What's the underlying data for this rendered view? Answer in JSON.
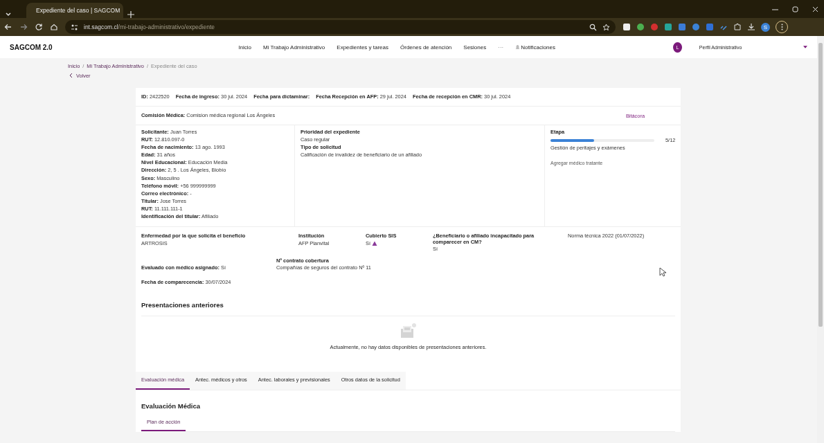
{
  "browser": {
    "tab_title": "Expediente del caso | SAGCOM",
    "url_host": "int.sagcom.cl",
    "url_path": "/mi-trabajo-administrativo/expediente",
    "profile_initial": "S"
  },
  "app": {
    "brand": "SAGCOM 2.0",
    "nav": [
      {
        "label": "Inicio",
        "kind": "link"
      },
      {
        "label": "Mi Trabajo Administrativo",
        "kind": "link"
      },
      {
        "label": "Expedientes y tareas",
        "kind": "link"
      },
      {
        "label": "Órdenes de atención",
        "kind": "link"
      },
      {
        "label": "Sesiones",
        "kind": "link"
      },
      {
        "label": "···",
        "kind": "more"
      },
      {
        "label": "Notificaciones",
        "kind": "bell"
      }
    ],
    "avatar_initial": "L",
    "profile": "Perfil Administrativo"
  },
  "breadcrumbs": [
    "Inicio",
    "Mi Trabajo Administrativo",
    "Expediente del caso"
  ],
  "breadcrumb_separator": "/",
  "back": "Volver",
  "header_fields": [
    {
      "label": "ID:",
      "value": "2422520"
    },
    {
      "label": "Fecha de ingreso:",
      "value": "30 jul. 2024"
    },
    {
      "label": "Fecha para dictaminar:"
    },
    {
      "label": "Fecha Recepción en AFP:",
      "value": "29 jul. 2024"
    },
    {
      "label": "Fecha de recepción en CMR:",
      "value": "30 jul. 2024"
    }
  ],
  "commission": {
    "label": "Comisión Médica:",
    "value": "Comision médica regional Los Ángeles"
  },
  "log_link": "Bitácora",
  "applicant": [
    {
      "label": "Solicitante:",
      "value": "Juan Torres"
    },
    {
      "label": "RUT:",
      "value": "12.810.097-0"
    },
    {
      "label": "Fecha de nacimiento:",
      "value": "13 ago. 1993"
    },
    {
      "label": "Edad:",
      "value": "31 años"
    },
    {
      "label": "Nivel Educacional:",
      "value": "Educación Media"
    },
    {
      "label": "Dirección:",
      "value": "2, 5 . Los Ángeles, Biobío"
    },
    {
      "label": "Sexo:",
      "value": "Masculino"
    },
    {
      "label": "Teléfono móvil:",
      "value": "+56 999999999"
    },
    {
      "label": "Correo electrónico:",
      "value": "-"
    },
    {
      "label": "Titular:",
      "value": "Jose Torres"
    },
    {
      "label": "RUT:",
      "value": "11.111.111-1"
    },
    {
      "label": "Identificación del titular:",
      "value": "Afiliado"
    }
  ],
  "request": [
    {
      "heading": "Prioridad del expediente",
      "value": "Caso regular"
    },
    {
      "heading": "Tipo de solicitud",
      "value": "Calificación de invalidez de beneficiario de un afiliado"
    }
  ],
  "stage": {
    "label": "Etapa",
    "level": 0.42,
    "count": "5/12",
    "name": "Gestión de peritajes y exámenes",
    "link": "Agregar médico tratante"
  },
  "details": {
    "disease": {
      "label": "Enfermedad por la que solicita el beneficio",
      "value": "ARTROSIS"
    },
    "institution": {
      "label": "Institución",
      "value": "AFP Planvital"
    },
    "sis": {
      "label": "Cubierto SIS",
      "value": "Sí",
      "warning": true
    },
    "incapacitated": {
      "label": "¿Beneficiario o afiliado incapacitado para comparecer en CM?",
      "value": "Sí"
    },
    "norm": "Norma técnica 2022 (01/07/2022)",
    "contract": {
      "label": "Nº contrato cobertura",
      "value": "Compañías de seguros del contrato Nº 11"
    },
    "evaluated": {
      "label": "Evaluado con médico asignado:",
      "value": "Sí"
    },
    "appearance": {
      "label": "Fecha de comparecencia:",
      "value": "30/07/2024"
    }
  },
  "previous": {
    "title": "Presentaciones anteriores",
    "empty_message": "Actualmente, no hay datos disponibles de presentaciones anteriores."
  },
  "tabs": [
    {
      "label": "Evaluación médica",
      "selected": true
    },
    {
      "label": "Antec. médicos y otros",
      "selected": false
    },
    {
      "label": "Antec. laborales y previsionales",
      "selected": false
    },
    {
      "label": "Otros datos de la solicitud",
      "selected": false
    }
  ],
  "evaluation": {
    "title": "Evaluación Médica",
    "subtabs": [
      {
        "label": "Plan de acción",
        "selected": true
      }
    ]
  }
}
